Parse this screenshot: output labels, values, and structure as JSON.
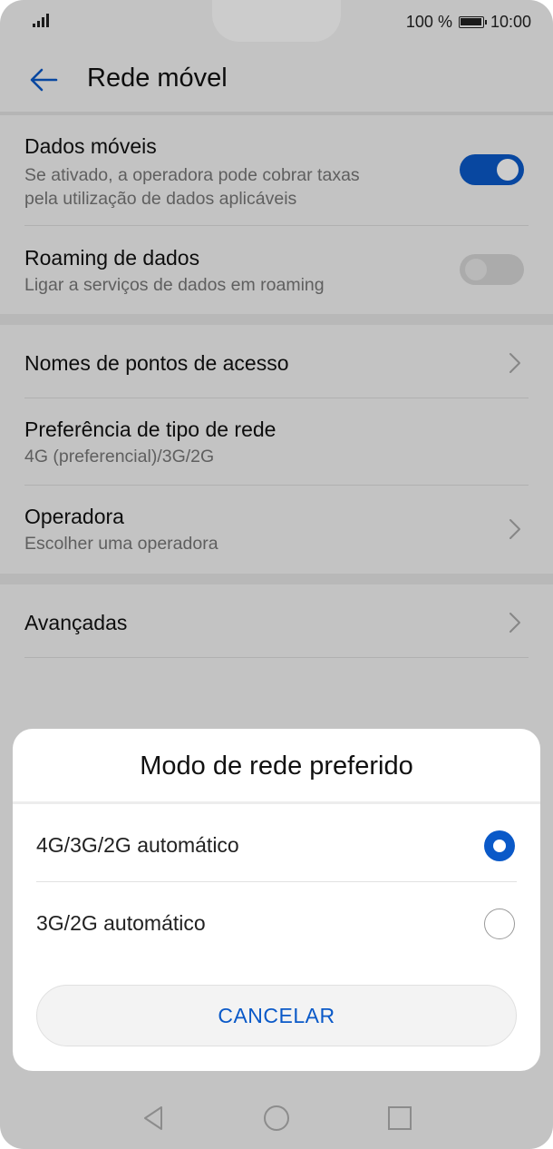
{
  "status_bar": {
    "battery_text": "100 %",
    "time": "10:00"
  },
  "header": {
    "title": "Rede móvel"
  },
  "settings": {
    "dados_moveis": {
      "title": "Dados móveis",
      "subtitle_line1": "Se ativado, a operadora pode cobrar taxas",
      "subtitle_line2": "pela utilização de dados aplicáveis",
      "enabled": true
    },
    "roaming": {
      "title": "Roaming de dados",
      "subtitle": "Ligar a serviços de dados em roaming",
      "enabled": false
    },
    "apn": {
      "title": "Nomes de pontos de acesso"
    },
    "network_type": {
      "title": "Preferência de tipo de rede",
      "subtitle": "4G (preferencial)/3G/2G"
    },
    "operator": {
      "title": "Operadora",
      "subtitle": "Escolher uma operadora"
    },
    "advanced": {
      "title": "Avançadas"
    }
  },
  "dialog": {
    "title": "Modo de rede preferido",
    "options": [
      {
        "label": "4G/3G/2G automático",
        "selected": true
      },
      {
        "label": "3G/2G automático",
        "selected": false
      }
    ],
    "cancel_label": "CANCELAR"
  },
  "colors": {
    "accent": "#0a59c8",
    "background": "#f4f4f4"
  },
  "icons": {
    "back": "arrow-left-icon",
    "chevron": "chevron-right-icon",
    "nav_back": "triangle-back-icon",
    "nav_home": "circle-home-icon",
    "nav_recent": "square-recent-icon"
  }
}
